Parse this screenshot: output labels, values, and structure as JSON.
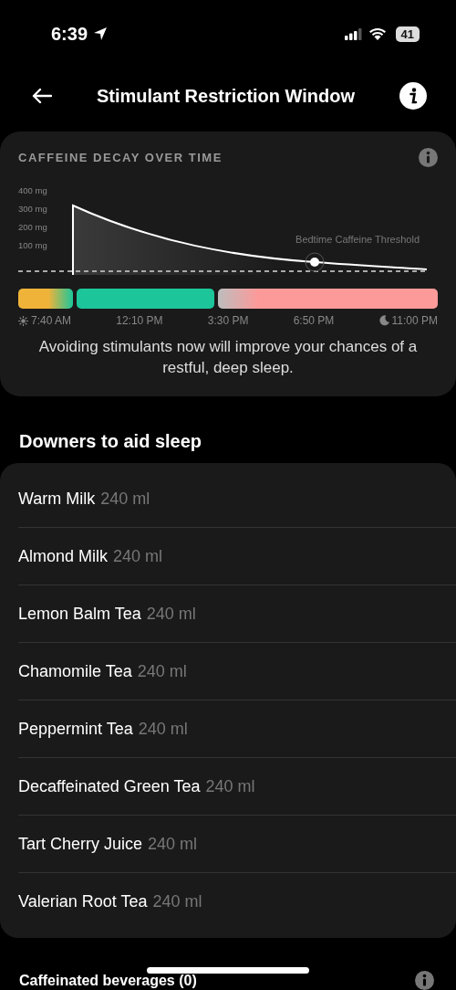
{
  "status_bar": {
    "time": "6:39",
    "battery": "41"
  },
  "header": {
    "title": "Stimulant Restriction Window"
  },
  "decay_card": {
    "title": "CAFFEINE DECAY OVER TIME",
    "y_labels": [
      "400 mg",
      "300 mg",
      "200 mg",
      "100 mg"
    ],
    "threshold_label": "Bedtime Caffeine Threshold",
    "segments": [
      {
        "color": "#f0b33a"
      },
      {
        "color": "#1cc69a"
      },
      {
        "color": "#fc9a9a"
      }
    ],
    "times": [
      {
        "label": "7:40 AM",
        "kind": "sun"
      },
      {
        "label": "12:10 PM",
        "kind": "none"
      },
      {
        "label": "3:30 PM",
        "kind": "none"
      },
      {
        "label": "6:50 PM",
        "kind": "none"
      },
      {
        "label": "11:00 PM",
        "kind": "moon"
      }
    ],
    "message": "Avoiding stimulants now will improve your chances of a restful, deep sleep."
  },
  "downers": {
    "heading": "Downers to aid sleep",
    "items": [
      {
        "name": "Warm Milk",
        "amount": "240 ml"
      },
      {
        "name": "Almond Milk",
        "amount": "240 ml"
      },
      {
        "name": "Lemon Balm Tea",
        "amount": "240 ml"
      },
      {
        "name": "Chamomile Tea",
        "amount": "240 ml"
      },
      {
        "name": "Peppermint Tea",
        "amount": "240 ml"
      },
      {
        "name": "Decaffeinated Green Tea",
        "amount": "240 ml"
      },
      {
        "name": "Tart Cherry Juice",
        "amount": "240 ml"
      },
      {
        "name": "Valerian Root Tea",
        "amount": "240 ml"
      }
    ]
  },
  "caffeinated": {
    "heading": "Caffeinated beverages (0)"
  }
}
